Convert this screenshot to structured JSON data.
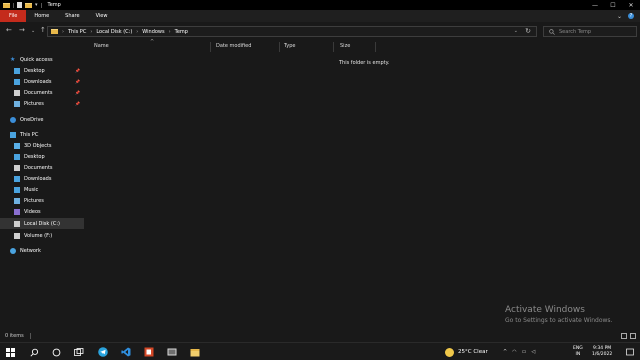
{
  "window": {
    "title": "Temp",
    "controls": [
      "—",
      "☐",
      "✕"
    ]
  },
  "ribbon": {
    "tabs": [
      "File",
      "Home",
      "Share",
      "View"
    ]
  },
  "address": {
    "crumbs": [
      "This PC",
      "Local Disk (C:)",
      "Windows",
      "Temp"
    ],
    "search_placeholder": "Search Temp"
  },
  "sidebar": {
    "items": [
      {
        "label": "Quick access",
        "icon": "star-icon",
        "color": "#3b8ed8",
        "pinned": false
      },
      {
        "label": "Desktop",
        "icon": "desktop-folder-icon",
        "color": "#4aa3df",
        "pinned": true
      },
      {
        "label": "Downloads",
        "icon": "download-icon",
        "color": "#4aa3df",
        "pinned": true
      },
      {
        "label": "Documents",
        "icon": "documents-icon",
        "color": "#cfcfcf",
        "pinned": true
      },
      {
        "label": "Pictures",
        "icon": "pictures-icon",
        "color": "#6fb1e0",
        "pinned": true
      },
      {
        "label": "OneDrive",
        "icon": "cloud-icon",
        "color": "#3b8ed8",
        "pinned": false
      },
      {
        "label": "This PC",
        "icon": "computer-icon",
        "color": "#4aa3df",
        "pinned": false
      },
      {
        "label": "3D Objects",
        "icon": "cube-icon",
        "color": "#5ab0e8",
        "pinned": false
      },
      {
        "label": "Desktop",
        "icon": "desktop-folder-icon",
        "color": "#4aa3df",
        "pinned": false
      },
      {
        "label": "Documents",
        "icon": "documents-icon",
        "color": "#cfcfcf",
        "pinned": false
      },
      {
        "label": "Downloads",
        "icon": "download-icon",
        "color": "#4aa3df",
        "pinned": false
      },
      {
        "label": "Music",
        "icon": "music-icon",
        "color": "#4aa3df",
        "pinned": false
      },
      {
        "label": "Pictures",
        "icon": "pictures-icon",
        "color": "#6fb1e0",
        "pinned": false
      },
      {
        "label": "Videos",
        "icon": "videos-icon",
        "color": "#8a6fd0",
        "pinned": false
      },
      {
        "label": "Local Disk (C:)",
        "icon": "drive-icon",
        "color": "#cfcfcf",
        "pinned": false
      },
      {
        "label": "Volume (F:)",
        "icon": "drive-icon",
        "color": "#cfcfcf",
        "pinned": false
      },
      {
        "label": "Network",
        "icon": "network-icon",
        "color": "#4aa3df",
        "pinned": false
      }
    ],
    "selected_label": "Local Disk (C:)"
  },
  "columns": [
    "Name",
    "Date modified",
    "Type",
    "Size"
  ],
  "empty_message": "This folder is empty.",
  "watermark": {
    "title": "Activate Windows",
    "subtitle": "Go to Settings to activate Windows."
  },
  "status": {
    "items": "0 items"
  },
  "taskbar": {
    "apps": [
      "windows-logo-icon",
      "search-icon",
      "cortana-icon",
      "task-view-icon",
      "telegram-icon",
      "vscode-icon",
      "office-icon",
      "generic-app-icon",
      "file-explorer-icon"
    ],
    "weather": "25°C  Clear",
    "lang_top": "ENG",
    "lang_bottom": "IN",
    "time": "9:34 PM",
    "date": "1/6/2022"
  },
  "colors": {
    "accent_file_tab": "#c42b1c",
    "folder": "#e8b84a",
    "background": "#191919"
  }
}
